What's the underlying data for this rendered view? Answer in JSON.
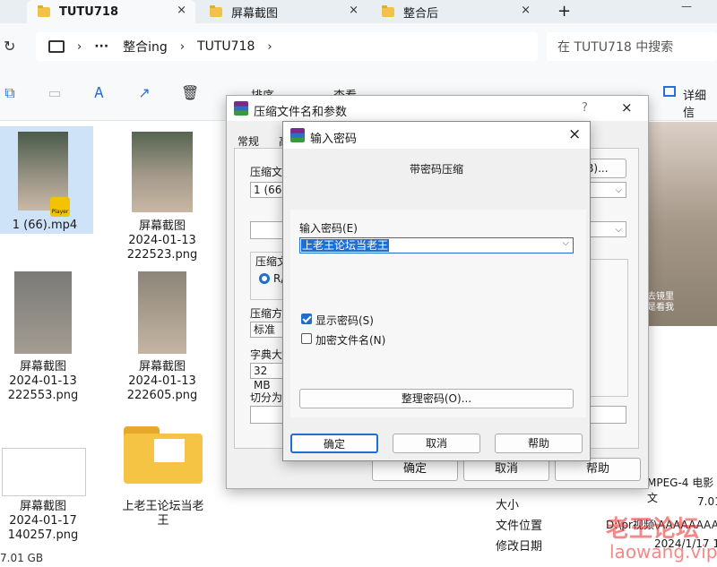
{
  "tabs": [
    {
      "label": "TUTU718",
      "active": true
    },
    {
      "label": "屏幕截图",
      "active": false
    },
    {
      "label": "整合后",
      "active": false
    }
  ],
  "titlebar": {
    "new_tab": "+",
    "minimize": "—",
    "close": "×"
  },
  "address": {
    "more": "···",
    "parts": [
      "整合ing",
      "TUTU718"
    ],
    "search_placeholder": "在 TUTU718 中搜索"
  },
  "toolbar": {
    "sort": "排序",
    "view": "查看",
    "more": "···",
    "details": "详细信"
  },
  "files": [
    {
      "name": "1 (66).mp4",
      "badge": "Player"
    },
    {
      "name": "屏幕截图",
      "date": "2024-01-13",
      "file": "222523.png"
    },
    {
      "name": "屏幕截图",
      "date": "2024-01-13",
      "file": "222553.png"
    },
    {
      "name": "屏幕截图",
      "date": "2024-01-13",
      "file": "222605.png"
    },
    {
      "name": "屏幕截图",
      "date": "2024-01-17",
      "file": "140257.png"
    },
    {
      "name": "上老王论坛当老",
      "name2": "王"
    }
  ],
  "statusbar": {
    "size": "7.01 GB"
  },
  "details": {
    "type_value": "MPEG-4 电影文",
    "size_label": "大小",
    "size_value": "7.01",
    "location_label": "文件位置",
    "location_value": "D:\\pr视频\\AAAAAAAAAAA",
    "modified_label": "修改日期",
    "modified_value": "2024/1/17 13"
  },
  "back_dialog": {
    "title": "压缩文件名和参数",
    "help_glyph": "?",
    "tab_general": "常规",
    "tab_second": "高",
    "archive_name_label": "压缩文件",
    "archive_name_value": "1 (66).",
    "browse_button": "(B)...",
    "format_label": "压缩文",
    "format_rar": "R/",
    "method_label": "压缩方",
    "method_value": "标准",
    "dict_label": "字典大小",
    "dict_value": "32 MB",
    "split_label": "切分为分",
    "ok": "确定",
    "cancel": "取消",
    "help": "帮助"
  },
  "password_dialog": {
    "title": "输入密码",
    "heading": "带密码压缩",
    "enter_label": "输入密码(E)",
    "password_value": "上老王论坛当老王",
    "show_password": "显示密码(S)",
    "show_password_checked": true,
    "encrypt_names": "加密文件名(N)",
    "encrypt_names_checked": false,
    "organize_button": "整理密码(O)...",
    "ok": "确定",
    "cancel": "取消",
    "help": "帮助"
  },
  "watermark": {
    "line1": "老王论坛",
    "line2": "laowang.vip"
  },
  "preview_caption": {
    "line1": "去镜里",
    "line2": "是看我"
  }
}
